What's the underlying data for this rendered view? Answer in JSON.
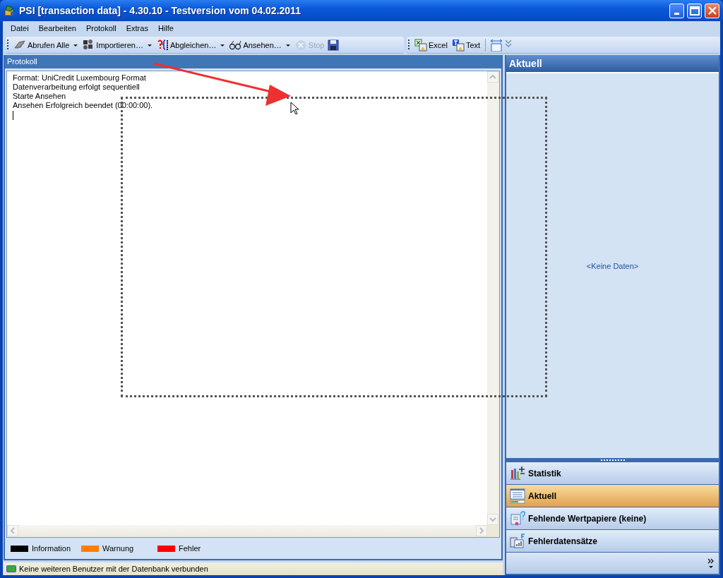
{
  "window": {
    "title": "PSI [transaction data] - 4.30.10 - Testversion vom 04.02.2011"
  },
  "menu": [
    "Datei",
    "Bearbeiten",
    "Protokoll",
    "Extras",
    "Hilfe"
  ],
  "toolbar": [
    {
      "kind": "dropdown",
      "label": "Abrufen Alle",
      "disabled": false
    },
    {
      "kind": "dropdown",
      "label": "Importieren…",
      "disabled": false
    },
    {
      "kind": "dropdown",
      "label": "Abgleichen…",
      "disabled": false
    },
    {
      "kind": "dropdown",
      "label": "Ansehen…",
      "disabled": false
    },
    {
      "kind": "button",
      "label": "Stop",
      "disabled": true
    },
    {
      "kind": "icon",
      "disabled": false
    }
  ],
  "toolbar_2": [
    {
      "kind": "button",
      "label": "Excel",
      "disabled": false
    },
    {
      "kind": "button",
      "label": "Text",
      "disabled": false
    },
    {
      "kind": "icon",
      "disabled": false
    },
    {
      "kind": "overflow",
      "disabled": false
    }
  ],
  "log": {
    "title": "Protokoll",
    "lines": [
      "Format: UniCredit Luxembourg Format",
      "Datenverarbeitung erfolgt sequentiell",
      "Starte Ansehen",
      "Ansehen Erfolgreich beendet (00:00:00)."
    ]
  },
  "legend": [
    {
      "label": "Information",
      "color": "#000000"
    },
    {
      "label": "Warnung",
      "color": "#ff7f00"
    },
    {
      "label": "Fehler",
      "color": "#ff0000"
    }
  ],
  "status_bar": {
    "text": "Keine weiteren Benutzer mit der Datenbank verbunden"
  },
  "side_panel": {
    "title": "Aktuell",
    "empty_text": "<Keine Daten>",
    "nav": [
      {
        "label": "Statistik",
        "selected": false
      },
      {
        "label": "Aktuell",
        "selected": true
      },
      {
        "label": "Fehlende Wertpapiere (keine)",
        "selected": false
      },
      {
        "label": "Fehlerdatensätze",
        "selected": false
      }
    ]
  }
}
